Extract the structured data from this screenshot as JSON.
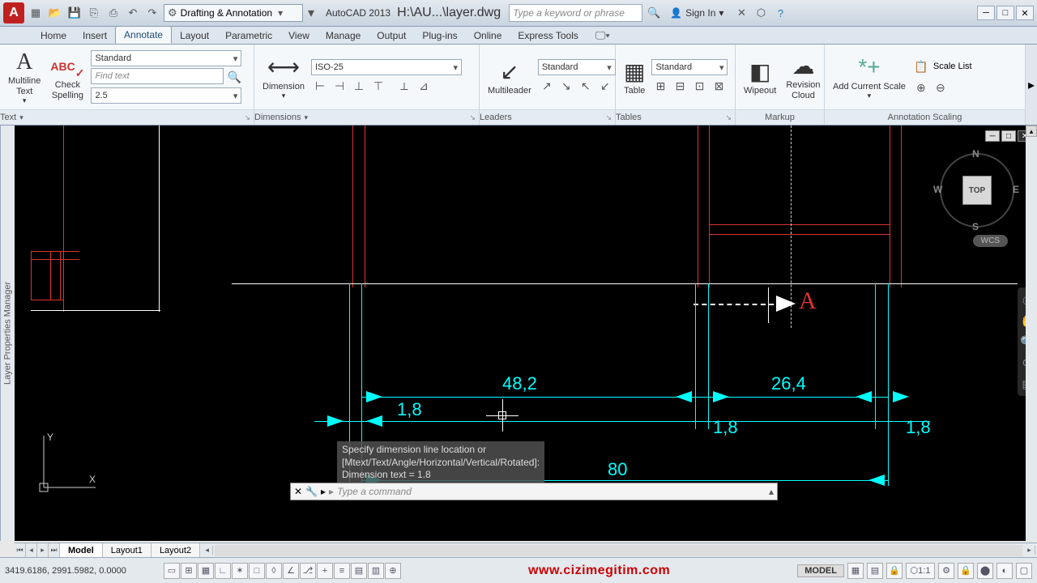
{
  "app": {
    "title": "AutoCAD 2013",
    "file": "H:\\AU...\\layer.dwg",
    "workspace": "Drafting & Annotation",
    "search_placeholder": "Type a keyword or phrase",
    "signin": "Sign In"
  },
  "tabs": [
    "Home",
    "Insert",
    "Annotate",
    "Layout",
    "Parametric",
    "View",
    "Manage",
    "Output",
    "Plug-ins",
    "Online",
    "Express Tools"
  ],
  "active_tab": "Annotate",
  "ribbon": {
    "text": {
      "big": "Multiline\nText",
      "check": "Check\nSpelling",
      "abc": "ABC",
      "style": "Standard",
      "find_ph": "Find text",
      "height": "2.5",
      "title": "Text"
    },
    "dimensions": {
      "big": "Dimension",
      "style": "ISO-25",
      "title": "Dimensions"
    },
    "leaders": {
      "big": "Multileader",
      "style": "Standard",
      "title": "Leaders"
    },
    "tables": {
      "big": "Table",
      "style": "Standard",
      "title": "Tables"
    },
    "markup": {
      "wipeout": "Wipeout",
      "revcloud": "Revision\nCloud",
      "title": "Markup"
    },
    "scaling": {
      "add": "Add Current Scale",
      "list": "Scale List",
      "title": "Annotation Scaling"
    }
  },
  "viewcube": {
    "face": "TOP",
    "n": "N",
    "e": "E",
    "s": "S",
    "w": "W",
    "wcs": "WCS"
  },
  "palette": "Layer Properties Manager",
  "dims": {
    "d1": "1,8",
    "d2": "48,2",
    "d3": "1,8",
    "d4": "26,4",
    "d5": "1,8",
    "total": "80"
  },
  "section_mark": "A",
  "cmd_history": [
    "Specify dimension line location or",
    "[Mtext/Text/Angle/Horizontal/Vertical/Rotated]:",
    "Dimension text = 1.8"
  ],
  "cmd_prompt": "Type a command",
  "sheets": {
    "tabs": [
      "Model",
      "Layout1",
      "Layout2"
    ],
    "active": "Model"
  },
  "status": {
    "coords": "3419.6186, 2991.5982, 0.0000",
    "model": "MODEL",
    "url": "www.cizimegitim.com"
  }
}
